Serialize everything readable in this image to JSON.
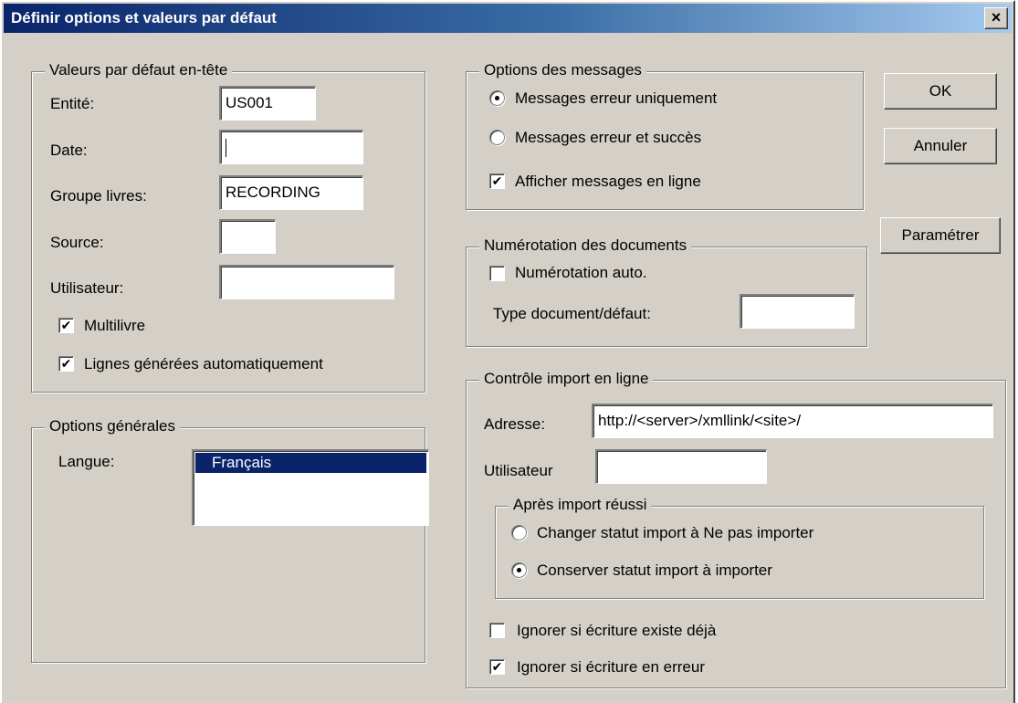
{
  "window": {
    "title": "Définir options et valeurs par défaut",
    "close_symbol": "×"
  },
  "header_defaults": {
    "legend": "Valeurs par défaut en-tête",
    "entity_label": "Entité:",
    "entity_value": "US001",
    "date_label": "Date:",
    "date_value": "",
    "ledger_group_label": "Groupe livres:",
    "ledger_group_value": "RECORDING",
    "source_label": "Source:",
    "source_value": "",
    "user_label": "Utilisateur:",
    "user_value": "",
    "multibook_label": "Multilivre",
    "multibook_checked": true,
    "auto_lines_label": "Lignes générées automatiquement",
    "auto_lines_checked": true
  },
  "general_options": {
    "legend": "Options générales",
    "language_label": "Langue:",
    "language_options": [
      "Français"
    ],
    "language_selected": "Français"
  },
  "message_options": {
    "legend": "Options des messages",
    "errors_only_label": "Messages erreur uniquement",
    "errors_and_success_label": "Messages erreur et succès",
    "selected": "errors_only",
    "show_online_label": "Afficher messages en ligne",
    "show_online_checked": true
  },
  "document_numbering": {
    "legend": "Numérotation des documents",
    "auto_label": "Numérotation auto.",
    "auto_checked": false,
    "doc_type_label": "Type document/défaut:",
    "doc_type_value": ""
  },
  "online_import": {
    "legend": "Contrôle import en ligne",
    "address_label": "Adresse:",
    "address_value": "http://<server>/xmllink/<site>/",
    "user_label": "Utilisateur",
    "user_value": "",
    "after_success_legend": "Après import réussi",
    "change_status_label": "Changer statut import à Ne pas importer",
    "keep_status_label": "Conserver statut import à importer",
    "after_success_selected": "keep_status",
    "ignore_exists_label": "Ignorer si écriture existe déjà",
    "ignore_exists_checked": false,
    "ignore_error_label": "Ignorer si écriture en erreur",
    "ignore_error_checked": true
  },
  "buttons": {
    "ok": "OK",
    "cancel": "Annuler",
    "setup": "Paramétrer"
  },
  "icons": {
    "checkmark": "✔"
  }
}
